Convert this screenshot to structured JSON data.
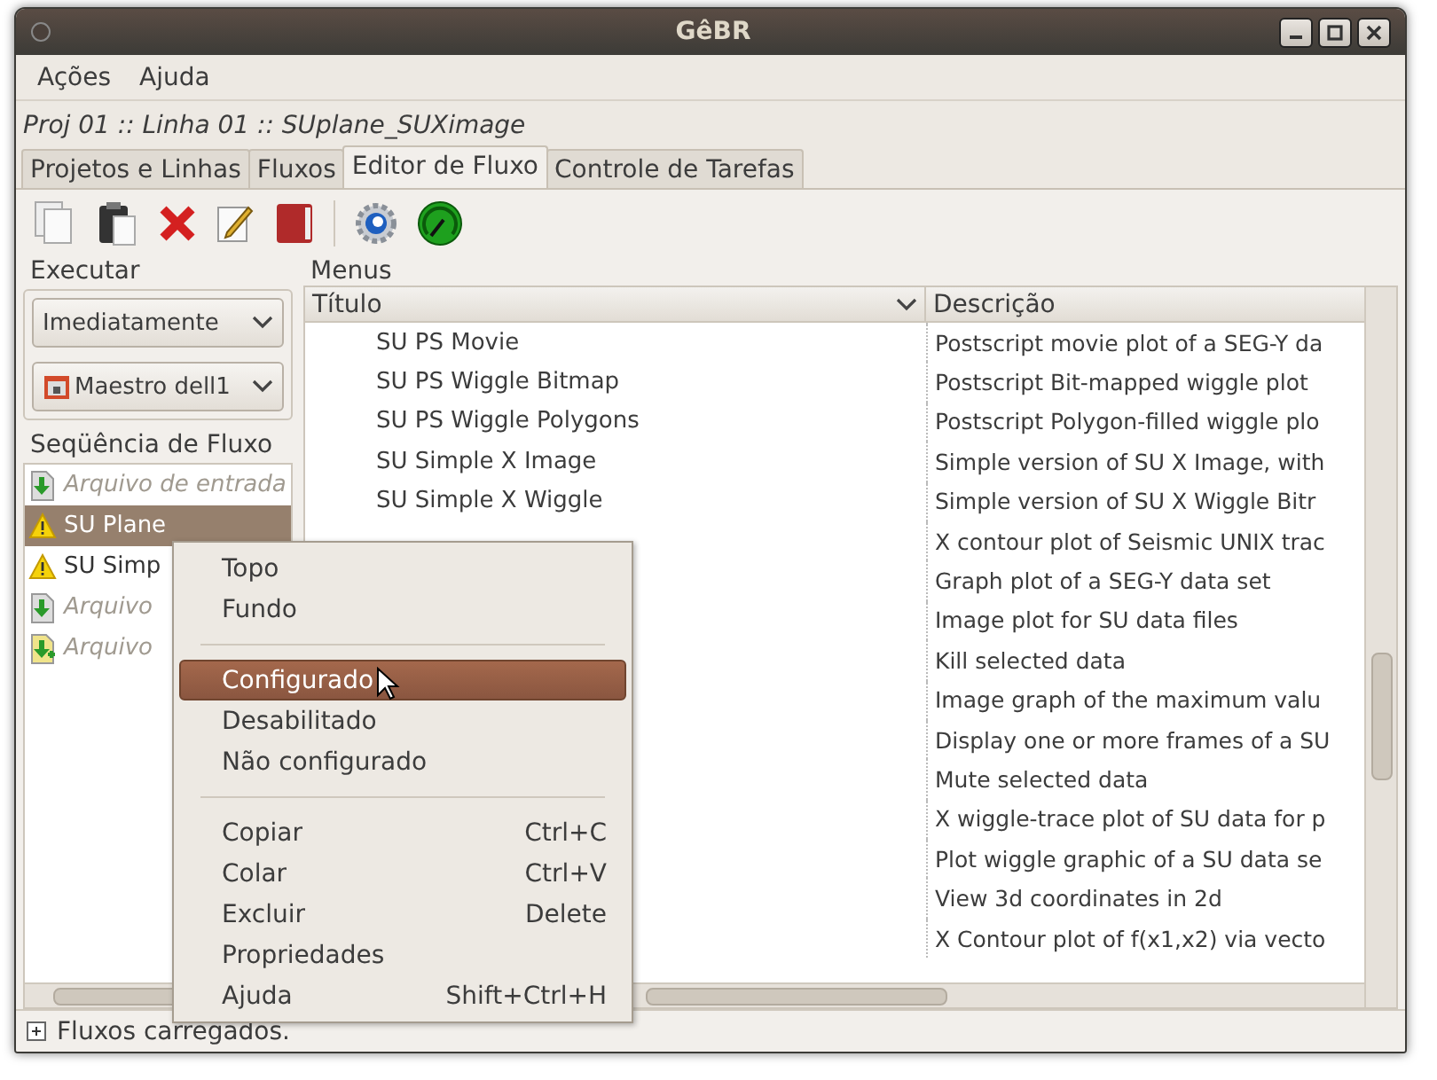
{
  "window": {
    "title": "GêBR"
  },
  "menubar": [
    "Ações",
    "Ajuda"
  ],
  "breadcrumb": "Proj 01 :: Linha 01 :: SUplane_SUXimage",
  "tabs": [
    {
      "label": "Projetos e Linhas",
      "selected": false
    },
    {
      "label": "Fluxos",
      "selected": false
    },
    {
      "label": "Editor de Fluxo",
      "selected": true
    },
    {
      "label": "Controle de Tarefas",
      "selected": false
    }
  ],
  "executar": {
    "label": "Executar",
    "mode": "Imediatamente",
    "server": "Maestro dell1"
  },
  "flow_sequence": {
    "label": "Seqüência de Fluxo",
    "items": [
      {
        "kind": "input",
        "label": "Arquivo de entrada",
        "selected": false
      },
      {
        "kind": "program",
        "label": "SU Plane",
        "selected": true
      },
      {
        "kind": "program",
        "label": "SU Simp",
        "selected": false
      },
      {
        "kind": "output",
        "label": "Arquivo",
        "selected": false
      },
      {
        "kind": "error",
        "label": "Arquivo",
        "selected": false
      }
    ]
  },
  "menus": {
    "label": "Menus",
    "columns": [
      "Título",
      "Descrição"
    ],
    "rows": [
      {
        "title": "SU PS Movie",
        "description": "Postscript movie plot of a SEG-Y da"
      },
      {
        "title": "SU PS Wiggle Bitmap",
        "description": "Postscript Bit-mapped wiggle plot"
      },
      {
        "title": "SU PS Wiggle Polygons",
        "description": "Postscript Polygon-filled wiggle plo"
      },
      {
        "title": "SU Simple X Image",
        "description": "Simple version of SU X Image, with"
      },
      {
        "title": "SU Simple X Wiggle",
        "description": "Simple version of SU X Wiggle Bitr"
      },
      {
        "description": "X contour plot of Seismic UNIX trac"
      },
      {
        "description": "Graph plot of a SEG-Y data set"
      },
      {
        "description": "Image plot for SU data files"
      },
      {
        "description": "Kill selected data"
      },
      {
        "description": "Image graph of the maximum valu"
      },
      {
        "description": "Display one or more frames of a SU"
      },
      {
        "description": "Mute selected data"
      },
      {
        "description": "X wiggle-trace plot of SU data for p"
      },
      {
        "description": "Plot wiggle graphic of a SU data se"
      },
      {
        "description": "View 3d coordinates in 2d"
      },
      {
        "description": "X Contour plot of f(x1,x2) via vecto"
      }
    ]
  },
  "context_menu": [
    {
      "kind": "item",
      "label": "Topo",
      "selected": false
    },
    {
      "kind": "item",
      "label": "Fundo",
      "selected": false
    },
    {
      "kind": "separator"
    },
    {
      "kind": "item",
      "label": "Configurado",
      "selected": true
    },
    {
      "kind": "item",
      "label": "Desabilitado",
      "selected": false
    },
    {
      "kind": "item",
      "label": "Não configurado",
      "selected": false
    },
    {
      "kind": "separator"
    },
    {
      "kind": "item",
      "label": "Copiar",
      "shortcut": "Ctrl+C",
      "selected": false
    },
    {
      "kind": "item",
      "label": "Colar",
      "shortcut": "Ctrl+V",
      "selected": false
    },
    {
      "kind": "item",
      "label": "Excluir",
      "shortcut": "Delete",
      "selected": false
    },
    {
      "kind": "item",
      "label": "Propriedades",
      "selected": false
    },
    {
      "kind": "item",
      "label": "Ajuda",
      "shortcut": "Shift+Ctrl+H",
      "selected": false
    }
  ],
  "status_bar": "Fluxos carregados."
}
